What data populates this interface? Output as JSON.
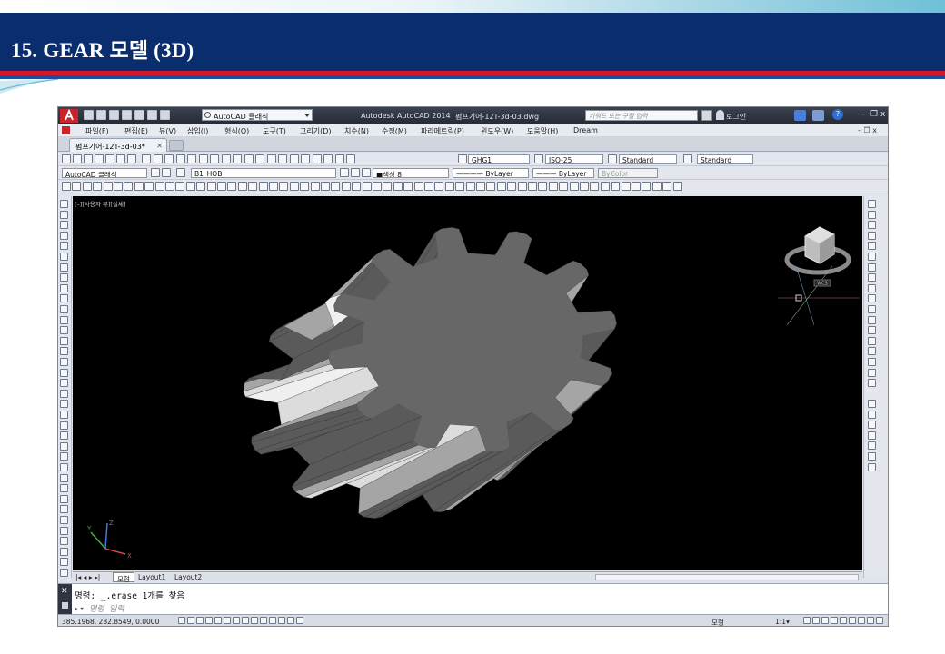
{
  "slide": {
    "title": "15.  GEAR 모델 (3D)",
    "colors": {
      "title_bg": "#0a2d6e",
      "red_rule": "#d6182a",
      "blue_rule": "#1b4d9c"
    }
  },
  "app": {
    "workspace": "AutoCAD 클래식",
    "app_name": "Autodesk AutoCAD 2014",
    "document": "펌프기어-12T-3d-03.dwg",
    "search_placeholder": "키워드 또는 구절 입력",
    "login": "로그인",
    "window_controls": {
      "minimize": "–",
      "restore": "❐",
      "close": "x"
    }
  },
  "menu": [
    "파일(F)",
    "편집(E)",
    "뷰(V)",
    "삽입(I)",
    "형식(O)",
    "도구(T)",
    "그리기(D)",
    "치수(N)",
    "수정(M)",
    "파라메트릭(P)",
    "윈도우(W)",
    "도움말(H)",
    "Dream"
  ],
  "tabs": {
    "active": "펌프기어-12T-3d-03*",
    "close": "✕"
  },
  "toolbars": {
    "text_style": "GHG1",
    "dim_style": "ISO-25",
    "table_style": "Standard",
    "multileader_style": "Standard",
    "workspace_combo": "AutoCAD 클래식",
    "layer": "B1_HOB",
    "color": "■색상 8",
    "linetype": "———— ByLayer",
    "lineweight": "——— ByLayer",
    "plot_style": "ByColor"
  },
  "viewport": {
    "label": "[–][사용자 뷰][실체]",
    "viewcube_label": "WCS",
    "axis": {
      "x": "X",
      "y": "Y",
      "z": "Z"
    },
    "gear_teeth": 12
  },
  "layout_tabs": [
    "모형",
    "Layout1",
    "Layout2"
  ],
  "command": {
    "line1": "명령: _.erase 1개를 찾음",
    "prompt": "명령 입력",
    "close": "✕"
  },
  "status": {
    "coords": "385.1968, 282.8549, 0.0000",
    "model": "모형",
    "scale": "1:1▾"
  },
  "icons": {
    "app": "autocad-logo-icon",
    "help": "?"
  }
}
